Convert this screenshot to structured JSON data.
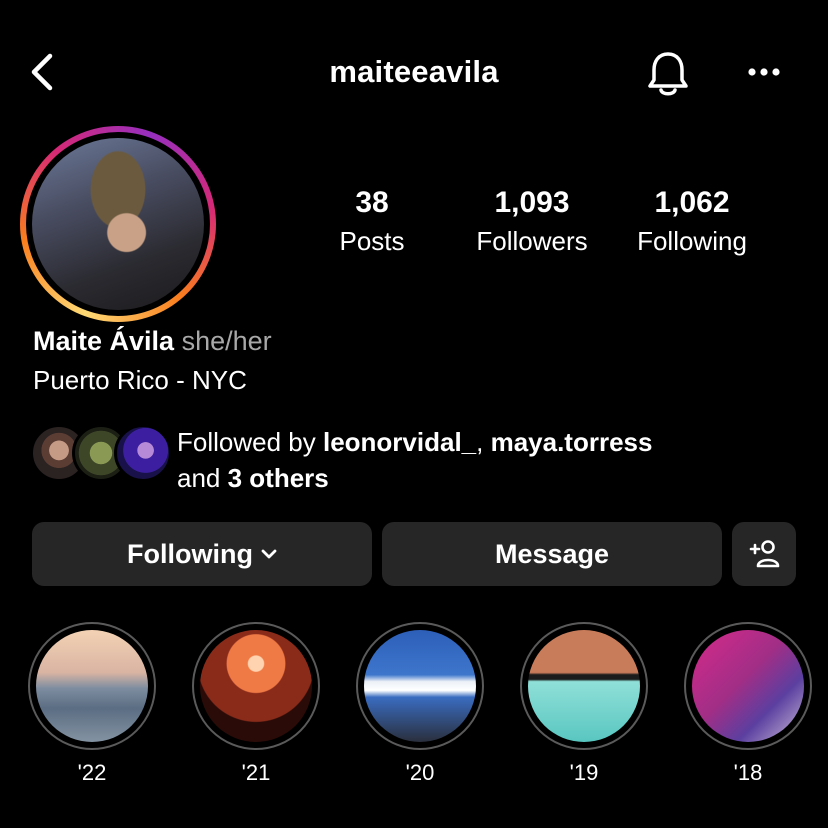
{
  "header": {
    "username": "maiteeavila",
    "back_icon": "chevron-left-icon",
    "bell_icon": "bell-icon",
    "more_icon": "more-horizontal-icon"
  },
  "profile": {
    "display_name": "Maite Ávila",
    "pronouns": "she/her",
    "bio": "Puerto Rico - NYC",
    "story_ring_colors": [
      "#feda75",
      "#fa7e1e",
      "#d62976",
      "#962fbf"
    ]
  },
  "stats": [
    {
      "value": "38",
      "label": "Posts"
    },
    {
      "value": "1,093",
      "label": "Followers"
    },
    {
      "value": "1,062",
      "label": "Following"
    }
  ],
  "followed_by": {
    "prefix": "Followed by ",
    "user1": "leonorvidal_",
    "separator": ", ",
    "user2": "maya.torress",
    "and_text": "and ",
    "others": "3 others"
  },
  "actions": {
    "following_label": "Following",
    "message_label": "Message",
    "add_user_icon": "add-user-icon"
  },
  "highlights": [
    {
      "label": "'22"
    },
    {
      "label": "'21"
    },
    {
      "label": "'20"
    },
    {
      "label": "'19"
    },
    {
      "label": "'18"
    }
  ]
}
